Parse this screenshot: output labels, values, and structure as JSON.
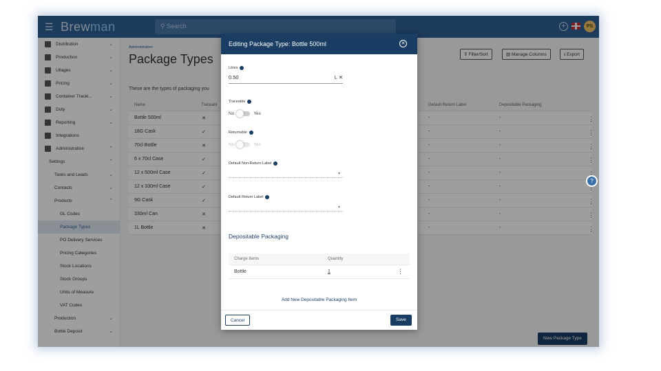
{
  "header": {
    "logo_a": "Brew",
    "logo_b": "man",
    "search_placeholder": "Search",
    "avatar": "PS"
  },
  "sidebar": {
    "items": [
      {
        "label": "Distribution"
      },
      {
        "label": "Production"
      },
      {
        "label": "Ullages"
      },
      {
        "label": "Pricing"
      },
      {
        "label": "Container Tracki..."
      },
      {
        "label": "Duty"
      },
      {
        "label": "Reporting"
      },
      {
        "label": "Integrations"
      },
      {
        "label": "Administration"
      },
      {
        "label": "Settings"
      },
      {
        "label": "Tasks and Leads"
      },
      {
        "label": "Contacts"
      },
      {
        "label": "Products"
      },
      {
        "label": "GL Codes"
      },
      {
        "label": "Package Types"
      },
      {
        "label": "PO Delivery Services"
      },
      {
        "label": "Pricing Categories"
      },
      {
        "label": "Stock Locations"
      },
      {
        "label": "Stock Groups"
      },
      {
        "label": "Units of Measure"
      },
      {
        "label": "VAT Codes"
      },
      {
        "label": "Production"
      },
      {
        "label": "Bottle Deposit"
      }
    ]
  },
  "main": {
    "breadcrumb": "Administration",
    "title": "Package Types",
    "description": "These are the types of packaging you",
    "toolbar": {
      "filter": "Filter/Sort",
      "columns": "Manage Columns",
      "export": "Export"
    },
    "columns": [
      "Name",
      "Traceabl",
      "Default Return Label",
      "Depositable Packaging"
    ],
    "rows": [
      {
        "name": "Bottle 500ml",
        "mark": "✕",
        "ret": "-",
        "dep": "-"
      },
      {
        "name": "18G Cask",
        "mark": "✓",
        "ret": "-",
        "dep": "-"
      },
      {
        "name": "70cl Bottle",
        "mark": "✕",
        "ret": "-",
        "dep": "-"
      },
      {
        "name": "6 x 70cl Case",
        "mark": "✓",
        "ret": "-",
        "dep": "-"
      },
      {
        "name": "12 x 500ml Case",
        "mark": "✓",
        "ret": "-",
        "dep": "-"
      },
      {
        "name": "12 x 330ml Case",
        "mark": "✓",
        "ret": "-",
        "dep": "-"
      },
      {
        "name": "9G Cask",
        "mark": "✓",
        "ret": "-",
        "dep": "-"
      },
      {
        "name": "330ml Can",
        "mark": "✕",
        "ret": "-",
        "dep": "-"
      },
      {
        "name": "1L Bottle",
        "mark": "✕",
        "ret": "-",
        "dep": "-"
      }
    ],
    "new_button": "New Package Type"
  },
  "modal": {
    "title": "Editing Package Type: Bottle 500ml",
    "litres_label": "Litres",
    "litres_value": "0.50",
    "litres_unit": "L",
    "traceable_label": "Traceable",
    "returnable_label": "Returnable",
    "no": "No",
    "yes": "Yes",
    "non_return_label": "Default Non-Return Label",
    "return_label": "Default Return Label",
    "section": "Depositable Packaging",
    "col_charge": "Charge Items",
    "col_qty": "Quantity",
    "dep_item": "Bottle",
    "dep_qty": "1",
    "add_link": "Add New Depositable Packaging Item",
    "cancel": "Cancel",
    "save": "Save"
  }
}
